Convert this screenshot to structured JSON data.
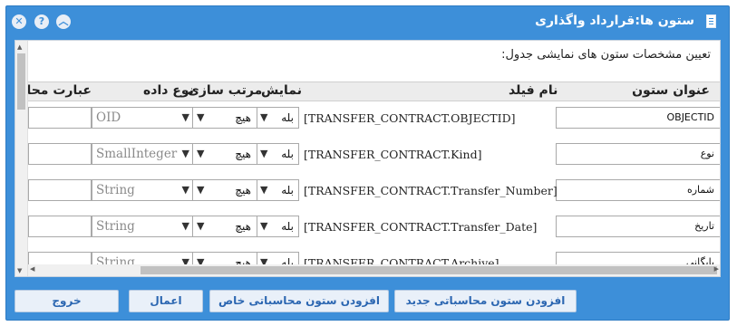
{
  "window": {
    "title": "ستون ها:قرارداد واگذاری",
    "buttons": [
      {
        "name": "close-button",
        "glyph": "✕"
      },
      {
        "name": "help-button",
        "glyph": "?"
      },
      {
        "name": "collapse-button",
        "glyph": "︿"
      }
    ]
  },
  "caption": "تعیین مشخصات ستون های نمایشی جدول:",
  "grid": {
    "headers": {
      "column_title": "عنوان ستون",
      "field_name": "نام فیلد",
      "show": "نمایش",
      "sort": "مرتب سازی",
      "data_type": "نوع داده",
      "expression": "عبارت محاسباتی"
    },
    "rows": [
      {
        "title": "OBJECTID",
        "field": "[TRANSFER_CONTRACT.OBJECTID]",
        "show": "بله",
        "sort": "هیچ",
        "data_type": "OID",
        "expression": ""
      },
      {
        "title": "نوع",
        "field": "[TRANSFER_CONTRACT.Kind]",
        "show": "بله",
        "sort": "هیچ",
        "data_type": "SmallInteger",
        "expression": ""
      },
      {
        "title": "شماره",
        "field": "[TRANSFER_CONTRACT.Transfer_Number]",
        "show": "بله",
        "sort": "هیچ",
        "data_type": "String",
        "expression": ""
      },
      {
        "title": "تاریخ",
        "field": "[TRANSFER_CONTRACT.Transfer_Date]",
        "show": "بله",
        "sort": "هیچ",
        "data_type": "String",
        "expression": ""
      },
      {
        "title": "بایگانی",
        "field": "[TRANSFER_CONTRACT.Archive]",
        "show": "بله",
        "sort": "هیچ",
        "data_type": "String",
        "expression": ""
      }
    ]
  },
  "footer": {
    "add_new_calc_column": "افزودن ستون محاسباتی جدید",
    "add_special_calc_column": "افزودن ستون محاسباتی خاص",
    "apply": "اعمال",
    "exit": "خروج"
  },
  "colors": {
    "accent": "#3d8fd9",
    "button_bg": "#e9f0f9",
    "button_text": "#2b66b1"
  }
}
